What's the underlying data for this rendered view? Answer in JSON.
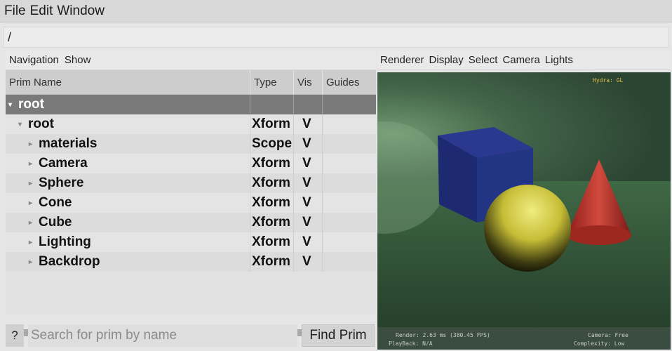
{
  "menubar": {
    "file": "File",
    "edit": "Edit",
    "window": "Window"
  },
  "path": "/",
  "left": {
    "menus": {
      "navigation": "Navigation",
      "show": "Show"
    },
    "columns": {
      "name": "Prim Name",
      "type": "Type",
      "vis": "Vis",
      "guides": "Guides"
    },
    "rows": [
      {
        "name": "root",
        "type": "",
        "vis": "",
        "expander": "▾"
      },
      {
        "name": "root",
        "type": "Xform",
        "vis": "V",
        "expander": "▾"
      },
      {
        "name": "materials",
        "type": "Scope",
        "vis": "V",
        "expander": "▸"
      },
      {
        "name": "Camera",
        "type": "Xform",
        "vis": "V",
        "expander": "▸"
      },
      {
        "name": "Sphere",
        "type": "Xform",
        "vis": "V",
        "expander": "▸"
      },
      {
        "name": "Cone",
        "type": "Xform",
        "vis": "V",
        "expander": "▸"
      },
      {
        "name": "Cube",
        "type": "Xform",
        "vis": "V",
        "expander": "▸"
      },
      {
        "name": "Lighting",
        "type": "Xform",
        "vis": "V",
        "expander": "▸"
      },
      {
        "name": "Backdrop",
        "type": "Xform",
        "vis": "V",
        "expander": "▸"
      }
    ],
    "help": "?",
    "search_placeholder": "Search for prim by name",
    "find_button": "Find Prim"
  },
  "right": {
    "menus": {
      "renderer": "Renderer",
      "display": "Display",
      "select": "Select",
      "camera": "Camera",
      "lights": "Lights"
    },
    "hud": {
      "renderer": "Hydra: GL",
      "render": "Render: 2.63 ms (380.45 FPS)",
      "playback": "PlayBack: N/A",
      "camera": "Camera: Free",
      "complexity": "Complexity: Low"
    }
  },
  "colors": {
    "selected_row": "#7a7a7a",
    "cube": "#1f2a7a",
    "sphere": "#c8c040",
    "cone": "#b8302a",
    "backdrop": "#3f5e3f"
  }
}
